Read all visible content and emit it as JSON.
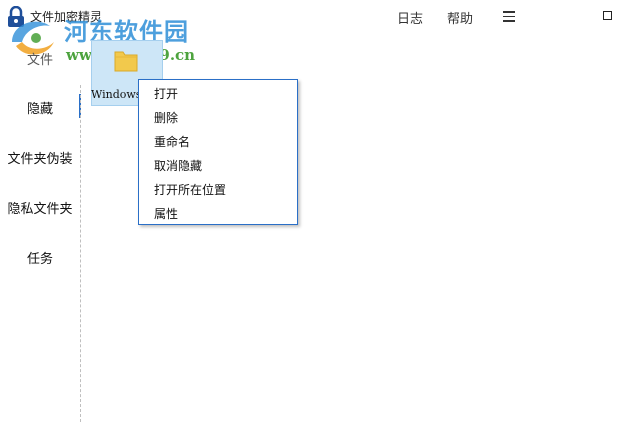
{
  "app": {
    "title": "文件加密精灵"
  },
  "watermark": {
    "site_name": "河东软件园",
    "url": "www.pc0359.cn"
  },
  "topbar": {
    "log_label": "日志",
    "help_label": "帮助",
    "menu_icon": "hamburger-icon",
    "maximize_icon": "maximize-icon"
  },
  "sidebar": {
    "items": [
      {
        "label": "文件"
      },
      {
        "label": "隐藏",
        "active": true
      },
      {
        "label": "文件夹伪装"
      },
      {
        "label": "隐私文件夹"
      },
      {
        "label": "任务"
      }
    ]
  },
  "main": {
    "file_name": "Windows10"
  },
  "context_menu": {
    "items": [
      {
        "label": "打开"
      },
      {
        "label": "删除"
      },
      {
        "label": "重命名"
      },
      {
        "label": "取消隐藏"
      },
      {
        "label": "打开所在位置"
      },
      {
        "label": "属性"
      }
    ]
  },
  "colors": {
    "accent": "#2a6fc7",
    "selection": "#cde6f7",
    "watermark_blue": "#2f8fd8",
    "watermark_green": "#3a9a2a"
  }
}
